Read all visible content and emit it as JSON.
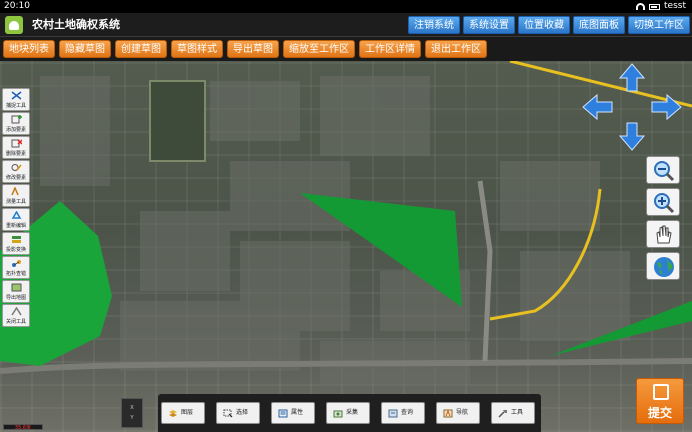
{
  "status_bar": {
    "time": "20:10",
    "user": "tesst"
  },
  "app": {
    "title": "农村土地确权系统"
  },
  "system_buttons": [
    "注销系统",
    "系统设置",
    "位置收藏",
    "底图面板",
    "切换工作区"
  ],
  "toolbar_buttons": [
    "地块列表",
    "隐藏草图",
    "创建草图",
    "草图样式",
    "导出草图",
    "缩放至工作区",
    "工作区详情",
    "退出工作区"
  ],
  "left_tools": [
    {
      "label": "捕捉工具",
      "icon": "snap-icon"
    },
    {
      "label": "添加要素",
      "icon": "add-feature-icon"
    },
    {
      "label": "删除要素",
      "icon": "delete-feature-icon"
    },
    {
      "label": "修改要素",
      "icon": "edit-feature-icon"
    },
    {
      "label": "测量工具",
      "icon": "measure-icon"
    },
    {
      "label": "重新编辑",
      "icon": "recycle-icon"
    },
    {
      "label": "投影变换",
      "icon": "projection-icon"
    },
    {
      "label": "拓扑查错",
      "icon": "topology-icon"
    },
    {
      "label": "导出地图",
      "icon": "export-map-icon"
    },
    {
      "label": "关闭工具",
      "icon": "close-tools-icon"
    }
  ],
  "bottom_tools": [
    {
      "label": "图层",
      "icon": "layers-icon"
    },
    {
      "label": "选择",
      "icon": "select-icon"
    },
    {
      "label": "属性",
      "icon": "attributes-icon"
    },
    {
      "label": "采集",
      "icon": "collect-icon"
    },
    {
      "label": "查询",
      "icon": "query-icon"
    },
    {
      "label": "导航",
      "icon": "navigation-icon"
    },
    {
      "label": "工具",
      "icon": "tools-icon"
    }
  ],
  "mini_box": {
    "top": "X",
    "bottom": "Y"
  },
  "submit": {
    "label": "提交"
  },
  "scale_bar": {
    "label": "35.6米"
  },
  "colors": {
    "accent_orange": "#e8821e",
    "accent_blue": "#2b75c9",
    "polygon_green": "#1aa53a",
    "road_yellow": "#e8c020"
  }
}
